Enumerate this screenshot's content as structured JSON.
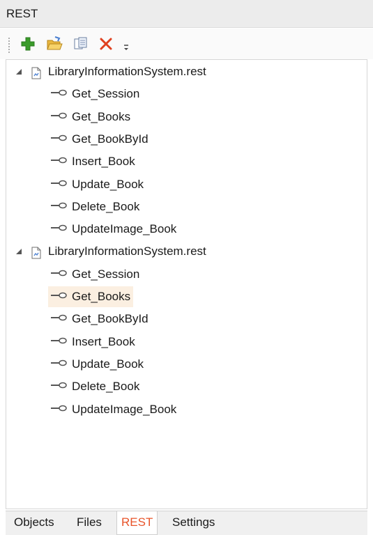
{
  "panel": {
    "title": "REST"
  },
  "toolbar": {
    "buttons": [
      {
        "name": "add-icon"
      },
      {
        "name": "open-folder-icon"
      },
      {
        "name": "copy-icon"
      },
      {
        "name": "delete-icon"
      }
    ]
  },
  "tree": {
    "groups": [
      {
        "label": "LibraryInformationSystem.rest",
        "expanded": true,
        "items": [
          "Get_Session",
          "Get_Books",
          "Get_BookById",
          "Insert_Book",
          "Update_Book",
          "Delete_Book",
          "UpdateImage_Book"
        ]
      },
      {
        "label": "LibraryInformationSystem.rest",
        "expanded": true,
        "items": [
          "Get_Session",
          "Get_Books",
          "Get_BookById",
          "Insert_Book",
          "Update_Book",
          "Delete_Book",
          "UpdateImage_Book"
        ],
        "selected": "Get_Books"
      }
    ]
  },
  "tabs": {
    "objects": "Objects",
    "files": "Files",
    "rest": "REST",
    "settings": "Settings",
    "active": "REST"
  },
  "colors": {
    "accent": "#e8542a",
    "selection": "#fbefe1",
    "header": "#ececec"
  }
}
